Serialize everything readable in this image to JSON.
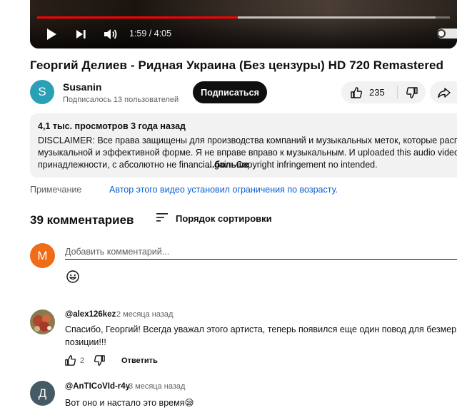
{
  "player": {
    "time": "1:59 / 4:05",
    "progress": 0.486
  },
  "video": {
    "title": "Георгий Делиев - Ридная Украина (Без цензуры) HD 720 Remastered"
  },
  "channel": {
    "avatar_letter": "S",
    "name": "Susanin",
    "subscribers": "Подписалось 13 пользователей",
    "subscribe_label": "Подписаться"
  },
  "actions": {
    "likes": "235"
  },
  "description": {
    "meta": "4,1 тыс. просмотров  3 года назад",
    "line1": "DISCLAIMER: Все права защищены для производства компаний и музыкальных меток, которые расп",
    "line2": "музыкальной и эффективной форме. Я не вправе вправо к музыкальным. И uploaded this audio video",
    "line3": "принадлежности, с абсолютно не financial gain. Copyright infringement no intended.",
    "more": "...больше"
  },
  "note": {
    "label": "Примечание",
    "text": "Автор этого видео установил ограничения по возрасту."
  },
  "comments": {
    "count_label": "39 комментариев",
    "sort_label": "Порядок сортировки",
    "user_avatar_letter": "M",
    "input_placeholder": "Добавить комментарий...",
    "reply_label": "Ответить",
    "items": [
      {
        "author": "@alex126kez",
        "time": "2 месяца назад",
        "line1": "Спасибо, Георгий! Всегда уважал этого артиста, теперь появился еще один повод для безмерн",
        "line2": "позиции!!!",
        "likes": "2"
      },
      {
        "author": "@AnTICoVId-r4y",
        "time": "3 месяца назад",
        "avatar_letter": "Д",
        "line1": "Вот оно и настало это время",
        "emoji": "😪"
      }
    ]
  },
  "colors": {
    "accent_red": "#ff0000",
    "link_blue": "#065fd4",
    "channel_avatar": "#2aa0b7",
    "user_avatar": "#ef6c18",
    "comment2_avatar": "#455a64"
  }
}
